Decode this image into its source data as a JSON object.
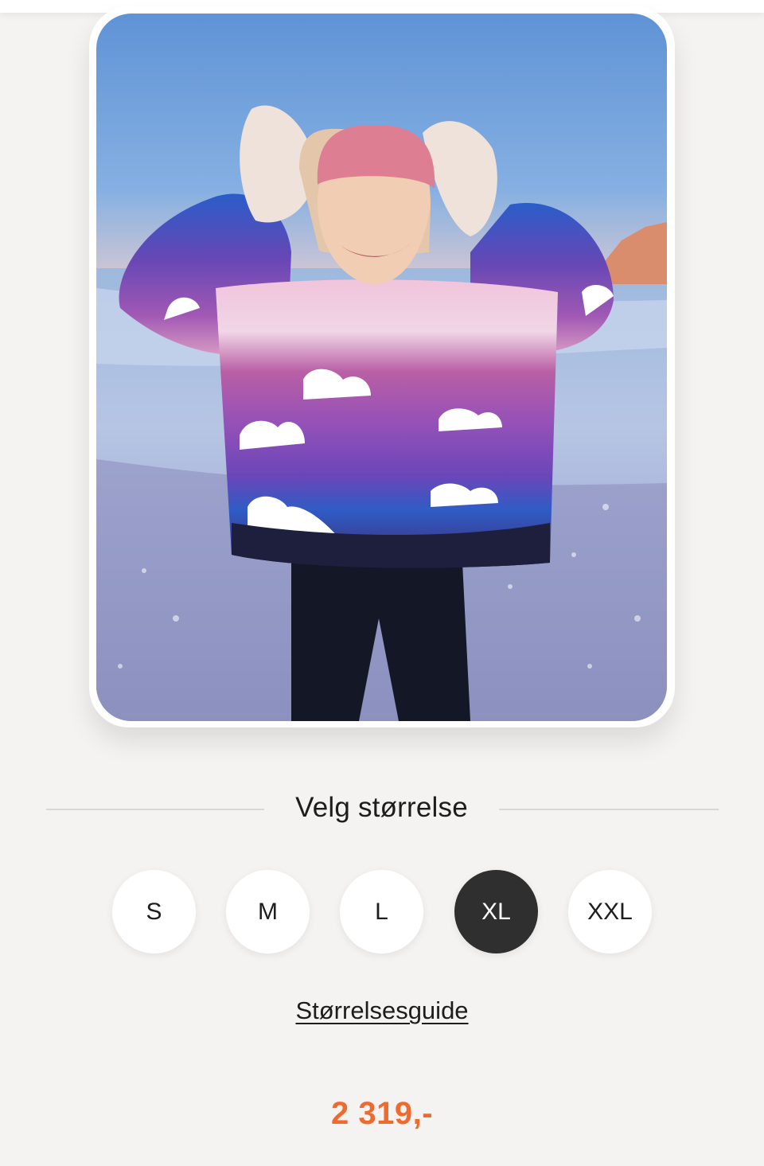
{
  "product": {
    "image_alt": "Woman in colorful knitted sweater with cloud pattern on a beach"
  },
  "size_selector": {
    "title": "Velg størrelse",
    "options": [
      {
        "label": "S",
        "selected": false
      },
      {
        "label": "M",
        "selected": false
      },
      {
        "label": "L",
        "selected": false
      },
      {
        "label": "XL",
        "selected": true
      },
      {
        "label": "XXL",
        "selected": false
      }
    ],
    "guide_label": "Størrelsesguide"
  },
  "price": {
    "label": "2 319,-"
  },
  "colors": {
    "accent": "#ee6a2f",
    "selected_size_bg": "#2f2f2f",
    "background": "#f5f3f1"
  }
}
